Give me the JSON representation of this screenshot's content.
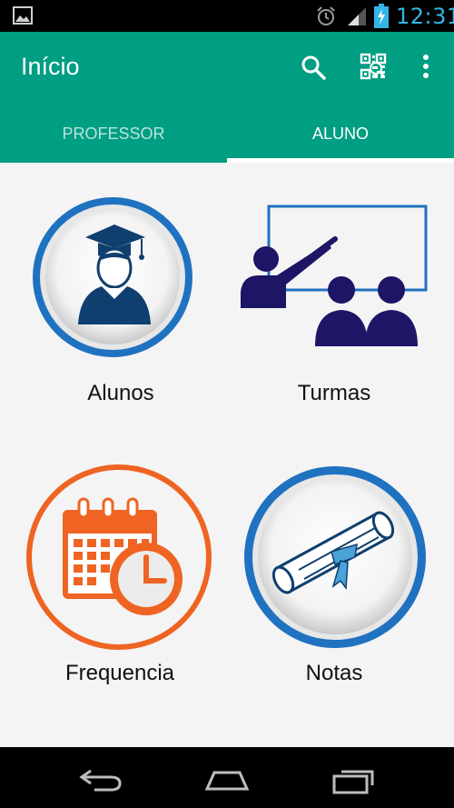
{
  "status_bar": {
    "time": "12:31",
    "icons": [
      "gallery-icon",
      "alarm-icon",
      "signal-icon",
      "battery-charging-icon"
    ]
  },
  "app_bar": {
    "title": "Início",
    "actions": [
      "search-icon",
      "qr-code-icon",
      "more-vert-icon"
    ]
  },
  "tabs": [
    {
      "label": "PROFESSOR",
      "selected": false
    },
    {
      "label": "ALUNO",
      "selected": true
    }
  ],
  "menu": [
    {
      "label": "Alunos",
      "icon": "student-graduate-icon"
    },
    {
      "label": "Turmas",
      "icon": "classroom-teacher-icon"
    },
    {
      "label": "Frequencia",
      "icon": "calendar-clock-icon"
    },
    {
      "label": "Notas",
      "icon": "diploma-icon"
    }
  ],
  "nav_bar": {
    "icons": [
      "back-icon",
      "home-icon",
      "recents-icon"
    ]
  },
  "colors": {
    "primary": "#009e82",
    "accent_blue": "#1f72c0",
    "navy": "#1d1566",
    "orange": "#ef6422",
    "clock_blue": "#33b5e5"
  }
}
